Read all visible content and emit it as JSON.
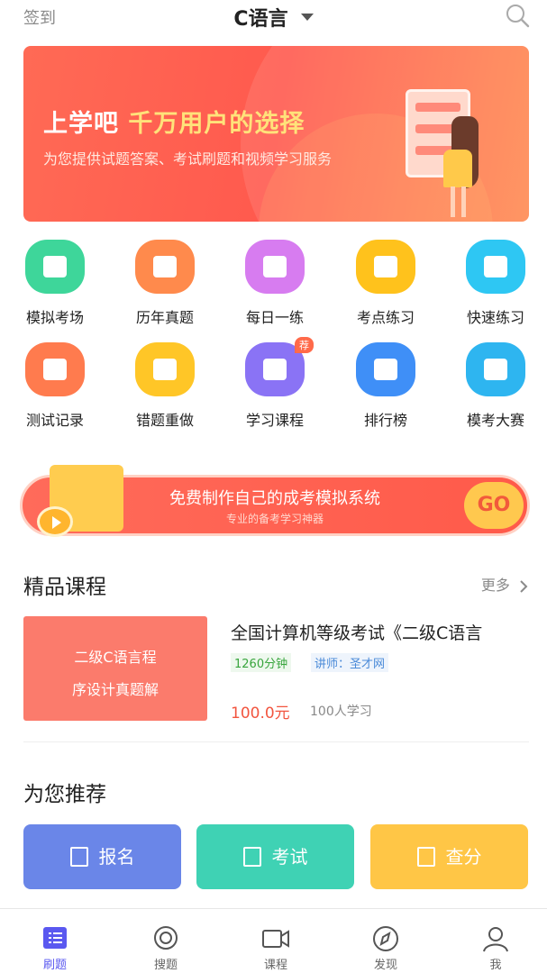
{
  "header": {
    "checkin_label": "签到",
    "title": "C语言"
  },
  "banner": {
    "title_part1": "上学吧 ",
    "title_part2": "千万用户的选择",
    "subtitle": "为您提供试题答案、考试刷题和视频学习服务"
  },
  "grid": [
    {
      "label": "模拟考场",
      "color": "#3ed69a"
    },
    {
      "label": "历年真题",
      "color": "#ff8a4c"
    },
    {
      "label": "每日一练",
      "color": "#d77cf0"
    },
    {
      "label": "考点练习",
      "color": "#ffc21c"
    },
    {
      "label": "快速练习",
      "color": "#2ec7f3"
    },
    {
      "label": "测试记录",
      "color": "#ff7b4e"
    },
    {
      "label": "错题重做",
      "color": "#ffc627"
    },
    {
      "label": "学习课程",
      "color": "#8a73f5",
      "badge": "荐"
    },
    {
      "label": "排行榜",
      "color": "#3f8ff7"
    },
    {
      "label": "模考大赛",
      "color": "#2eb5f0"
    }
  ],
  "promo": {
    "title": "免费制作自己的成考模拟系统",
    "subtitle": "专业的备考学习神器",
    "go_label": "GO"
  },
  "courses": {
    "title": "精品课程",
    "more_label": "更多",
    "item": {
      "thumb_line1": "二级C语言程",
      "thumb_line2": "序设计真题解",
      "name": "全国计算机等级考试《二级C语言",
      "duration": "1260分钟",
      "teacher": "讲师：圣才网",
      "price": "100.0元",
      "learners": "100人学习"
    }
  },
  "recommend": {
    "title": "为您推荐",
    "buttons": [
      {
        "label": "报名",
        "color": "#6a86e8"
      },
      {
        "label": "考试",
        "color": "#3fd2b4"
      },
      {
        "label": "查分",
        "color": "#ffc646"
      }
    ]
  },
  "nav": [
    {
      "label": "刷题",
      "active": true
    },
    {
      "label": "搜题"
    },
    {
      "label": "课程"
    },
    {
      "label": "发现"
    },
    {
      "label": "我"
    }
  ]
}
